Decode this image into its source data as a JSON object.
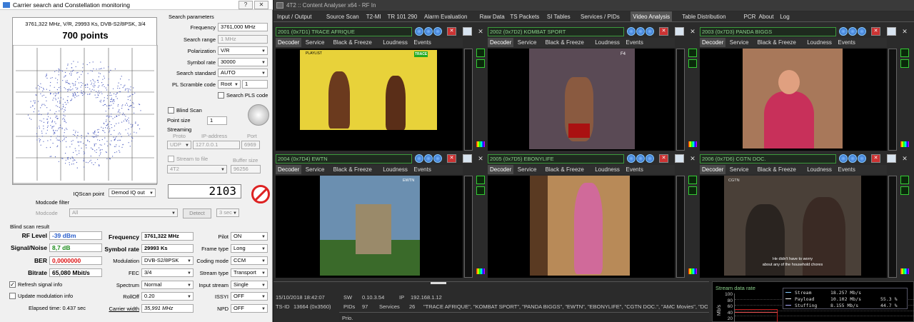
{
  "left_window": {
    "title": "Carrier search and Constellation monitoring",
    "help_label": "?",
    "close_label": "✕",
    "scope": {
      "info": "3761,322 MHz, V/R, 29993 Ks, DVB-S2/8PSK, 3/4",
      "points": "700 points"
    },
    "search_params": {
      "heading": "Search parameters",
      "frequency_label": "Frequency",
      "frequency_value": "3761,000 MHz",
      "search_range_label": "Search range",
      "search_range_value": "1 MHz",
      "polarization_label": "Polarization",
      "polarization_value": "V/R",
      "symbol_rate_label": "Symbol rate",
      "symbol_rate_value": "30000",
      "search_standard_label": "Search standard",
      "search_standard_value": "AUTO",
      "pl_scramble_label": "PL Scramble code",
      "pl_scramble_mode": "Root",
      "pl_scramble_value": "1",
      "search_pls_label": "Search PLS code"
    },
    "blind_scan_label": "Blind Scan",
    "point_size_label": "Point size",
    "point_size_value": "1",
    "streaming": {
      "heading": "Streaming",
      "proto_label": "Proto",
      "ip_label": "IP-address",
      "port_label": "Port",
      "proto_value": "UDP",
      "ip_value": "127.0.0.1",
      "port_value": "6969",
      "stream_to_file_label": "Stream to file",
      "buffer_size_label": "Buffer size",
      "file_value": "4T2",
      "buffer_value": "96256"
    },
    "counter": "2103",
    "iqscan_label": "IQScan point",
    "iqscan_value": "Demod IQ out",
    "modcode_filter_label": "Modcode filter",
    "modcode_label": "Modcode",
    "modcode_value": "All",
    "detect_label": "Detect",
    "detect_time": "3 sec",
    "blind_result": {
      "heading": "Blind scan result",
      "rf_level_label": "RF Level",
      "rf_level_value": "-39 dBm",
      "signal_noise_label": "Signal/Noise",
      "signal_noise_value": "8,7 dB",
      "ber_label": "BER",
      "ber_value": "0,0000000",
      "bitrate_label": "Bitrate",
      "bitrate_value": "65,080 Mbit/s",
      "frequency_label": "Frequency",
      "frequency_value": "3761,322 MHz",
      "symbol_rate_label": "Symbol rate",
      "symbol_rate_value": "29993 Ks",
      "modulation_label": "Modulation",
      "modulation_value": "DVB-S2/8PSK",
      "fec_label": "FEC",
      "fec_value": "3/4",
      "spectrum_label": "Spectrum",
      "spectrum_value": "Normal",
      "rolloff_label": "RollOff",
      "rolloff_value": "0.20",
      "carrier_width_label": "Carrier width",
      "carrier_width_value": "35,991 MHz",
      "pilot_label": "Pilot",
      "pilot_value": "ON",
      "frame_type_label": "Frame type",
      "frame_type_value": "Long",
      "coding_mode_label": "Coding mode",
      "coding_mode_value": "CCM",
      "stream_type_label": "Stream type",
      "stream_type_value": "Transport",
      "input_stream_label": "Input stream",
      "input_stream_value": "Single",
      "issyi_label": "ISSYI",
      "issyi_value": "OFF",
      "npd_label": "NPD",
      "npd_value": "OFF"
    },
    "refresh_label": "Refresh signal info",
    "update_mod_label": "Update modulation info",
    "elapsed": "Elapsed time: 0.437 sec"
  },
  "right_window": {
    "title": "4T2 :: Content Analyser x64 - RF In",
    "menu": [
      "Input / Output",
      "Source Scan",
      "T2-MI",
      "TR 101 290",
      "Alarm Evaluation",
      "Raw Data",
      "TS Packets",
      "SI Tables",
      "Services / PIDs",
      "Video Analysis",
      "Table Distribution",
      "PCR",
      "About",
      "Log"
    ],
    "active_menu": "Video Analysis",
    "subtabs": [
      "Decoder",
      "Service",
      "Black & Freeze",
      "Loudness",
      "Events"
    ],
    "panes": [
      {
        "header": "2001 (0x7D1) TRACE AFRIQUE",
        "color": "#e8d23a"
      },
      {
        "header": "2002 (0x7D2) KOMBAT SPORT",
        "color": "#5a4a55"
      },
      {
        "header": "2003 (0x7D3) PANDA BIGGS",
        "color": "#a8785a"
      },
      {
        "header": "2004 (0x7D4) EWTN",
        "color": "#6b8fb0"
      },
      {
        "header": "2005 (0x7D5) EBONYLIFE",
        "color": "#b88a58"
      },
      {
        "header": "2006 (0x7D6) CGTN DOC.",
        "color": "#4a4038"
      }
    ],
    "overlays": {
      "trace_label": "PLAYLIST",
      "trace_logo": "TRACE",
      "kombat_logo": "F4",
      "ewtn_logo": "EWTN",
      "cgtn_logo": "CGTN",
      "cgtn_sub1": "He didn't have to worry",
      "cgtn_sub2": "about any of the household chores"
    },
    "status": {
      "datetime": "15/10/2018 18:42:07",
      "sw_label": "SW",
      "sw_value": "0.10.3.54",
      "ip_label": "IP",
      "ip_value": "192.168.1.12",
      "tsid_label": "TS-ID",
      "tsid_value": "13664 (0x3560)",
      "pids_label": "PIDs",
      "pids_value": "97",
      "services_label": "Services",
      "services_value": "26",
      "services_list": "\"TRACE AFRIQUE\", \"KOMBAT SPORT\", \"PANDA BIGGS\", \"EWTN\", \"EBONYLIFE\", \"CGTN DOC.\", \"AMC Movies\", \"DOVE TV\", \"",
      "prio_label": "Prio."
    },
    "rate": {
      "title": "Stream data rate",
      "ylabel": "Mb/s",
      "ticks": [
        "100",
        "80",
        "60",
        "40",
        "20"
      ],
      "legend": [
        {
          "name": "Stream",
          "value": "18.257 Mb/s",
          "pct": ""
        },
        {
          "name": "Payload",
          "value": "10.102 Mb/s",
          "pct": "55.3 %"
        },
        {
          "name": "Stuffing",
          "value": "8.155 Mb/s",
          "pct": "44.7 %"
        }
      ]
    }
  }
}
